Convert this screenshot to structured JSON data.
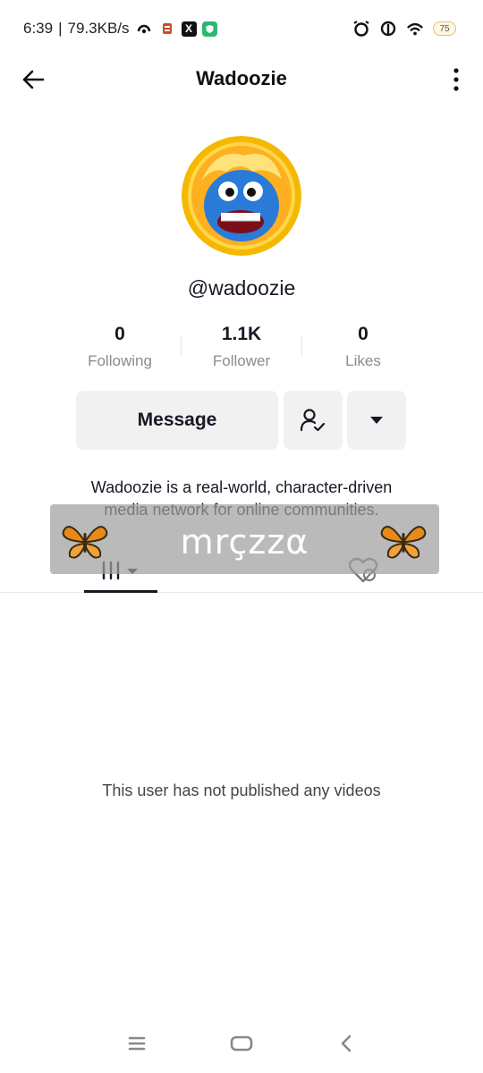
{
  "status_bar": {
    "time": "6:39",
    "speed": "79.3KB/s",
    "battery": "75"
  },
  "header": {
    "title": "Wadoozie"
  },
  "profile": {
    "username": "@wadoozie",
    "stats": [
      {
        "value": "0",
        "label": "Following"
      },
      {
        "value": "1.1K",
        "label": "Follower"
      },
      {
        "value": "0",
        "label": "Likes"
      }
    ],
    "message_label": "Message",
    "bio_line1": "Wadoozie is a real-world, character-driven",
    "bio_line2": "media network for online communities."
  },
  "watermark": {
    "text": "mrçzzα"
  },
  "content": {
    "empty_message": "This user has not published any videos"
  },
  "colors": {
    "avatar_ring": "#f5b800",
    "avatar_face": "#2a7ad8",
    "butterfly": "#e88a1a"
  },
  "icons": [
    "back-arrow-icon",
    "more-vertical-icon",
    "follow-check-icon",
    "caret-down-icon",
    "grid-videos-icon",
    "liked-hidden-icon",
    "butterfly-icon",
    "menu-icon",
    "home-icon",
    "back-nav-icon"
  ]
}
